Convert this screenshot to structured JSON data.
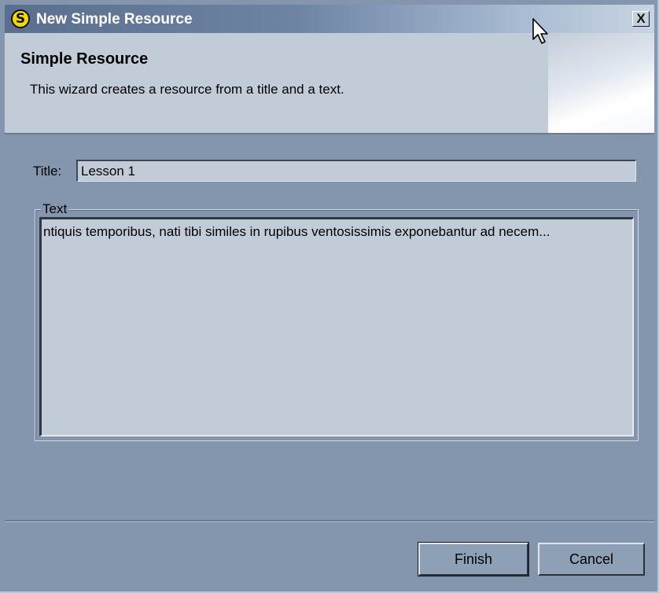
{
  "window": {
    "title": "New Simple Resource",
    "app_icon_letter": "S",
    "close_symbol": "X"
  },
  "banner": {
    "title": "Simple Resource",
    "description": "This wizard creates a resource from a title and a text."
  },
  "form": {
    "title_label": "Title:",
    "title_value": "Lesson 1",
    "text_group_label": "Text",
    "text_value": "ntiquis temporibus, nati tibi similes in rupibus ventosissimis exponebantur ad necem..."
  },
  "buttons": {
    "finish_label": "Finish",
    "cancel_label": "Cancel"
  },
  "colors": {
    "dialog_background": "#8496ad",
    "banner_background": "#c2ccd8",
    "app_icon": "#f5d800"
  },
  "icons": {
    "app": "s-logo-icon",
    "close": "close-icon",
    "cursor": "mouse-pointer-icon"
  }
}
